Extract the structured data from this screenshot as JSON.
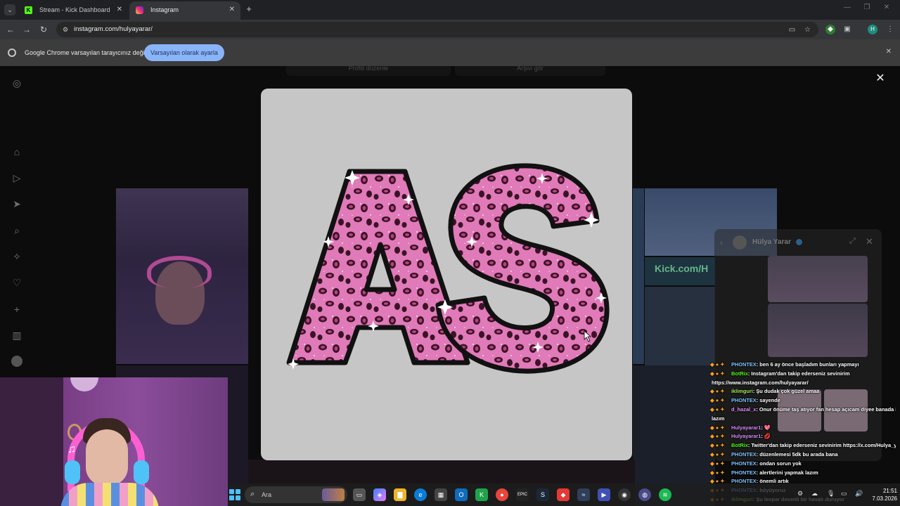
{
  "browser": {
    "tabs": [
      {
        "title": "Stream - Kick Dashboard",
        "favicon": "kick-icon",
        "active": false
      },
      {
        "title": "Instagram",
        "favicon": "instagram-icon",
        "active": true
      }
    ],
    "url": "instagram.com/hulyayarar/",
    "profile_initial": "H"
  },
  "infobar": {
    "message": "Google Chrome varsayılan tarayıcınız değil",
    "button": "Varsayılan olarak ayarla"
  },
  "instagram": {
    "profile_buttons": [
      "Profili düzenle",
      "Arşivi gör"
    ],
    "sidebar_icons": [
      "instagram-icon",
      "home-icon",
      "reels-icon",
      "send-icon",
      "search-icon",
      "explore-icon",
      "heart-icon",
      "create-icon",
      "stats-icon",
      "meta-icon"
    ],
    "tile_text": "Kick.com/H"
  },
  "dm_panel": {
    "name": "Hülya Yarar"
  },
  "chat": [
    {
      "user": "PHONTEX",
      "text": ": ben 6 ay önce başladım bunları yapmayı",
      "cls": ""
    },
    {
      "user": "BotRix",
      "text": ": Instagram'dan takip ederseniz sevinirim",
      "cls": "bot"
    },
    {
      "user": "",
      "text": "https://www.instagram.com/hulyayarar/",
      "cls": "cont"
    },
    {
      "user": "iklimguri",
      "text": ": Şu dudak çok güzel amaa",
      "cls": "mod"
    },
    {
      "user": "PHONTEX",
      "text": ": sayende",
      "cls": ""
    },
    {
      "user": "d_hazal_x",
      "text": ": Onur önüme taş atıyor fan hesap açıcam diyee banada içerik",
      "cls": "pink"
    },
    {
      "user": "",
      "text": "lazım",
      "cls": "cont"
    },
    {
      "user": "Hulyayarar1",
      "text": ": 💖",
      "cls": "purple"
    },
    {
      "user": "Hulyayarar1",
      "text": ": 💋",
      "cls": "purple"
    },
    {
      "user": "BotRix",
      "text": ": Twitter'dan takip ederseniz sevinirim https://x.com/Hulya_yarar",
      "cls": "bot"
    },
    {
      "user": "PHONTEX",
      "text": ": düzenlemesi 5dk bu arada bana",
      "cls": ""
    },
    {
      "user": "PHONTEX",
      "text": ": ondan sorun yok",
      "cls": ""
    },
    {
      "user": "PHONTEX",
      "text": ": alertlerini yapmak lazım",
      "cls": ""
    },
    {
      "user": "PHONTEX",
      "text": ": önemli artık",
      "cls": ""
    },
    {
      "user": "PHONTEX",
      "text": ": büyüyoruz",
      "cls": ""
    },
    {
      "user": "iklimguri",
      "text": ": Şu leopar desenli bir havalı duruyor",
      "cls": "mod"
    }
  ],
  "taskbar": {
    "search_placeholder": "Ara",
    "time": "21:51",
    "date": "7.03.2026"
  },
  "colors": {
    "accent": "#8ab4f8",
    "kick_green": "#53fc18",
    "leopard_pink": "#e07ab8",
    "leopard_spot": "#3a1426"
  }
}
